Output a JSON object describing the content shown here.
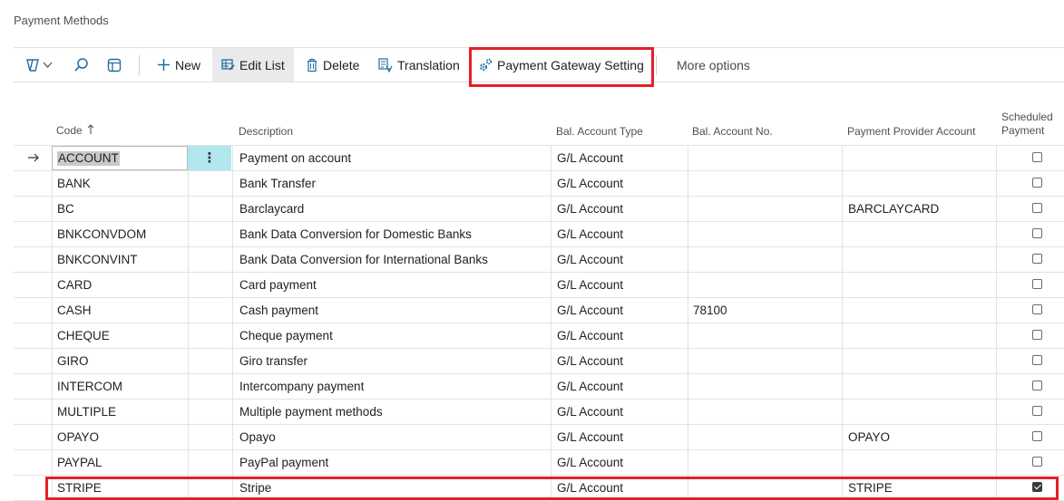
{
  "page": {
    "title": "Payment Methods"
  },
  "toolbar": {
    "new_label": "New",
    "edit_list_label": "Edit List",
    "delete_label": "Delete",
    "translation_label": "Translation",
    "gateway_label": "Payment Gateway Setting",
    "more_label": "More options",
    "icons": [
      "filter-views-icon",
      "chevron-down-icon",
      "search-icon",
      "layout-icon",
      "plus-icon",
      "edit-list-icon",
      "trash-icon",
      "translation-icon",
      "gear-icon"
    ]
  },
  "columns": {
    "code": "Code",
    "description": "Description",
    "bal_type": "Bal. Account Type",
    "bal_no": "Bal. Account No.",
    "provider": "Payment Provider Account",
    "scheduled_1": "Scheduled",
    "scheduled_2": "Payment"
  },
  "rows": [
    {
      "code": "ACCOUNT",
      "description": "Payment on account",
      "bal_type": "G/L Account",
      "bal_no": "",
      "provider": "",
      "scheduled": false
    },
    {
      "code": "BANK",
      "description": "Bank Transfer",
      "bal_type": "G/L Account",
      "bal_no": "",
      "provider": "",
      "scheduled": false
    },
    {
      "code": "BC",
      "description": "Barclaycard",
      "bal_type": "G/L Account",
      "bal_no": "",
      "provider": "BARCLAYCARD",
      "scheduled": false
    },
    {
      "code": "BNKCONVDOM",
      "description": "Bank Data Conversion for Domestic Banks",
      "bal_type": "G/L Account",
      "bal_no": "",
      "provider": "",
      "scheduled": false
    },
    {
      "code": "BNKCONVINT",
      "description": "Bank Data Conversion for International Banks",
      "bal_type": "G/L Account",
      "bal_no": "",
      "provider": "",
      "scheduled": false
    },
    {
      "code": "CARD",
      "description": "Card payment",
      "bal_type": "G/L Account",
      "bal_no": "",
      "provider": "",
      "scheduled": false
    },
    {
      "code": "CASH",
      "description": "Cash payment",
      "bal_type": "G/L Account",
      "bal_no": "78100",
      "provider": "",
      "scheduled": false
    },
    {
      "code": "CHEQUE",
      "description": "Cheque payment",
      "bal_type": "G/L Account",
      "bal_no": "",
      "provider": "",
      "scheduled": false
    },
    {
      "code": "GIRO",
      "description": "Giro transfer",
      "bal_type": "G/L Account",
      "bal_no": "",
      "provider": "",
      "scheduled": false
    },
    {
      "code": "INTERCOM",
      "description": "Intercompany payment",
      "bal_type": "G/L Account",
      "bal_no": "",
      "provider": "",
      "scheduled": false
    },
    {
      "code": "MULTIPLE",
      "description": "Multiple payment methods",
      "bal_type": "G/L Account",
      "bal_no": "",
      "provider": "",
      "scheduled": false
    },
    {
      "code": "OPAYO",
      "description": "Opayo",
      "bal_type": "G/L Account",
      "bal_no": "",
      "provider": "OPAYO",
      "scheduled": false
    },
    {
      "code": "PAYPAL",
      "description": "PayPal payment",
      "bal_type": "G/L Account",
      "bal_no": "",
      "provider": "",
      "scheduled": false
    },
    {
      "code": "STRIPE",
      "description": "Stripe",
      "bal_type": "G/L Account",
      "bal_no": "",
      "provider": "STRIPE",
      "scheduled": true
    }
  ],
  "colors": {
    "highlight": "#e3202a",
    "selected_cell": "#b3e7ee",
    "accent": "#1e6e9e"
  }
}
